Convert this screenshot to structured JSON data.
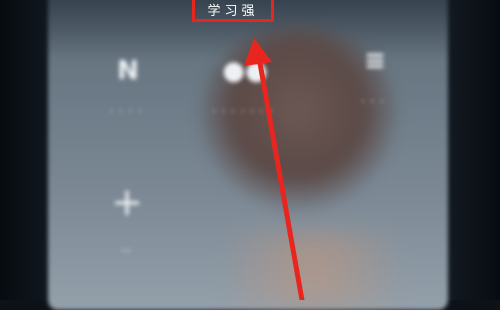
{
  "screen": {
    "tiles": [
      {
        "id": "left",
        "glyph": "N",
        "label": "····"
      },
      {
        "id": "mid",
        "glyph": "●●",
        "label": "·······"
      },
      {
        "id": "right",
        "glyph": "≡",
        "label": "···"
      },
      {
        "id": "plus",
        "glyph": "+",
        "label": ""
      },
      {
        "id": "small",
        "glyph": "··",
        "label": ""
      }
    ]
  },
  "annotation": {
    "highlight_text": "学习强",
    "color": "#e8261f"
  }
}
